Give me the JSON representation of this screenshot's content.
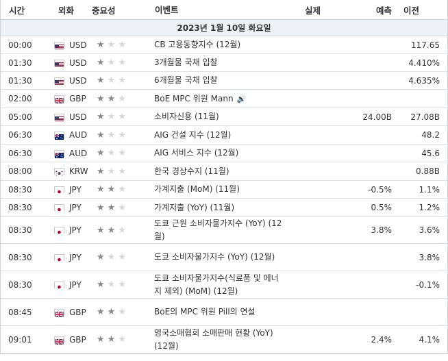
{
  "headers": {
    "time": "시간",
    "currency": "외화",
    "importance": "중요성",
    "event": "이벤트",
    "actual": "실제",
    "forecast": "예측",
    "previous": "이전"
  },
  "date_label": "2023년 1월 10일 화요일",
  "colors": {
    "border": "#cfd4dc",
    "date_bg": "#eef1f5",
    "star_on": "#888888",
    "star_off": "#d7d7d7"
  },
  "rows": [
    {
      "time": "00:00",
      "flag": "us-flag",
      "currency": "USD",
      "stars": 1,
      "event": "CB 고용동향지수 (12월)",
      "actual": "",
      "forecast": "",
      "previous": "117.65",
      "sound": false
    },
    {
      "time": "01:30",
      "flag": "us-flag",
      "currency": "USD",
      "stars": 1,
      "event": "3개월물 국채 입찰",
      "actual": "",
      "forecast": "",
      "previous": "4.410%",
      "sound": false
    },
    {
      "time": "01:30",
      "flag": "us-flag",
      "currency": "USD",
      "stars": 1,
      "event": "6개월물 국채 입찰",
      "actual": "",
      "forecast": "",
      "previous": "4.635%",
      "sound": false
    },
    {
      "time": "02:00",
      "flag": "gb-flag",
      "currency": "GBP",
      "stars": 2,
      "event": "BoE MPC 위원 Mann",
      "actual": "",
      "forecast": "",
      "previous": "",
      "sound": true
    },
    {
      "time": "05:00",
      "flag": "us-flag",
      "currency": "USD",
      "stars": 1,
      "event": "소비자신용 (11월)",
      "actual": "",
      "forecast": "24.00B",
      "previous": "27.08B",
      "sound": false
    },
    {
      "time": "06:30",
      "flag": "au-flag",
      "currency": "AUD",
      "stars": 1,
      "event": "AIG 건설 지수 (12월)",
      "actual": "",
      "forecast": "",
      "previous": "48.2",
      "sound": false
    },
    {
      "time": "06:30",
      "flag": "au-flag",
      "currency": "AUD",
      "stars": 1,
      "event": "AIG 서비스 지수 (12월)",
      "actual": "",
      "forecast": "",
      "previous": "45.6",
      "sound": false
    },
    {
      "time": "08:00",
      "flag": "kr-flag",
      "currency": "KRW",
      "stars": 1,
      "event": "한국 경상수지 (11월)",
      "actual": "",
      "forecast": "",
      "previous": "0.88B",
      "sound": false
    },
    {
      "time": "08:30",
      "flag": "jp-flag",
      "currency": "JPY",
      "stars": 2,
      "event": "가계지출 (MoM) (11월)",
      "actual": "",
      "forecast": "-0.5%",
      "previous": "1.1%",
      "sound": false
    },
    {
      "time": "08:30",
      "flag": "jp-flag",
      "currency": "JPY",
      "stars": 2,
      "event": "가계지출 (YoY) (11월)",
      "actual": "",
      "forecast": "0.5%",
      "previous": "1.2%",
      "sound": false
    },
    {
      "time": "08:30",
      "flag": "jp-flag",
      "currency": "JPY",
      "stars": 2,
      "event": "도쿄 근원 소비자물가지수 (YoY) (12월)",
      "actual": "",
      "forecast": "3.8%",
      "previous": "3.6%",
      "sound": false
    },
    {
      "time": "08:30",
      "flag": "jp-flag",
      "currency": "JPY",
      "stars": 1,
      "event": "도쿄 소비자물가지수 (YoY) (12월)",
      "actual": "",
      "forecast": "",
      "previous": "3.8%",
      "sound": false
    },
    {
      "time": "08:30",
      "flag": "jp-flag",
      "currency": "JPY",
      "stars": 1,
      "event": "도쿄 소비자물가지수(식료품 및 에너지 제외) (MoM) (12월)",
      "actual": "",
      "forecast": "",
      "previous": "-0.1%",
      "sound": false
    },
    {
      "time": "08:45",
      "flag": "gb-flag",
      "currency": "GBP",
      "stars": 2,
      "event": "BoE의 MPC 위원 Pill의 연설",
      "actual": "",
      "forecast": "",
      "previous": "",
      "sound": false
    },
    {
      "time": "09:01",
      "flag": "gb-flag",
      "currency": "GBP",
      "stars": 2,
      "event": "영국소매협회 소매판매 현황 (YoY) (12월)",
      "actual": "",
      "forecast": "2.4%",
      "previous": "4.1%",
      "sound": false
    }
  ]
}
